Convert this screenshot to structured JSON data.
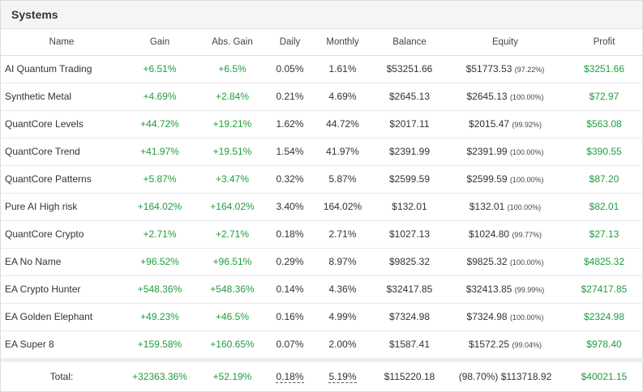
{
  "panel": {
    "title": "Systems"
  },
  "columns": [
    "Name",
    "Gain",
    "Abs. Gain",
    "Daily",
    "Monthly",
    "Balance",
    "Equity",
    "Profit"
  ],
  "rows": [
    {
      "name": "AI Quantum Trading",
      "gain": "+6.51%",
      "abs_gain": "+6.5%",
      "daily": "0.05%",
      "monthly": "1.61%",
      "balance": "$53251.66",
      "equity": "$51773.53",
      "equity_pct": "(97.22%)",
      "profit": "$3251.66"
    },
    {
      "name": "Synthetic Metal",
      "gain": "+4.69%",
      "abs_gain": "+2.84%",
      "daily": "0.21%",
      "monthly": "4.69%",
      "balance": "$2645.13",
      "equity": "$2645.13",
      "equity_pct": "(100.00%)",
      "profit": "$72.97"
    },
    {
      "name": "QuantCore Levels",
      "gain": "+44.72%",
      "abs_gain": "+19.21%",
      "daily": "1.62%",
      "monthly": "44.72%",
      "balance": "$2017.11",
      "equity": "$2015.47",
      "equity_pct": "(99.92%)",
      "profit": "$563.08"
    },
    {
      "name": "QuantCore Trend",
      "gain": "+41.97%",
      "abs_gain": "+19.51%",
      "daily": "1.54%",
      "monthly": "41.97%",
      "balance": "$2391.99",
      "equity": "$2391.99",
      "equity_pct": "(100.00%)",
      "profit": "$390.55"
    },
    {
      "name": "QuantCore Patterns",
      "gain": "+5.87%",
      "abs_gain": "+3.47%",
      "daily": "0.32%",
      "monthly": "5.87%",
      "balance": "$2599.59",
      "equity": "$2599.59",
      "equity_pct": "(100.00%)",
      "profit": "$87.20"
    },
    {
      "name": "Pure AI High risk",
      "gain": "+164.02%",
      "abs_gain": "+164.02%",
      "daily": "3.40%",
      "monthly": "164.02%",
      "balance": "$132.01",
      "equity": "$132.01",
      "equity_pct": "(100.00%)",
      "profit": "$82.01"
    },
    {
      "name": "QuantCore Crypto",
      "gain": "+2.71%",
      "abs_gain": "+2.71%",
      "daily": "0.18%",
      "monthly": "2.71%",
      "balance": "$1027.13",
      "equity": "$1024.80",
      "equity_pct": "(99.77%)",
      "profit": "$27.13"
    },
    {
      "name": "EA No Name",
      "gain": "+96.52%",
      "abs_gain": "+96.51%",
      "daily": "0.29%",
      "monthly": "8.97%",
      "balance": "$9825.32",
      "equity": "$9825.32",
      "equity_pct": "(100.00%)",
      "profit": "$4825.32"
    },
    {
      "name": "EA Crypto Hunter",
      "gain": "+548.36%",
      "abs_gain": "+548.36%",
      "daily": "0.14%",
      "monthly": "4.36%",
      "balance": "$32417.85",
      "equity": "$32413.85",
      "equity_pct": "(99.99%)",
      "profit": "$27417.85"
    },
    {
      "name": "EA Golden Elephant",
      "gain": "+49.23%",
      "abs_gain": "+46.5%",
      "daily": "0.16%",
      "monthly": "4.99%",
      "balance": "$7324.98",
      "equity": "$7324.98",
      "equity_pct": "(100.00%)",
      "profit": "$2324.98"
    },
    {
      "name": "EA Super 8",
      "gain": "+159.58%",
      "abs_gain": "+160.65%",
      "daily": "0.07%",
      "monthly": "2.00%",
      "balance": "$1587.41",
      "equity": "$1572.25",
      "equity_pct": "(99.04%)",
      "profit": "$978.40"
    }
  ],
  "total": {
    "label": "Total:",
    "gain": "+32363.36%",
    "abs_gain": "+52.19%",
    "daily": "0.18%",
    "monthly": "5.19%",
    "balance": "$115220.18",
    "equity": "(98.70%) $113718.92",
    "profit": "$40021.15"
  },
  "colors": {
    "positive": "#1f9d3f",
    "header_bg": "#f5f5f5",
    "separator": "#e9eef3"
  }
}
